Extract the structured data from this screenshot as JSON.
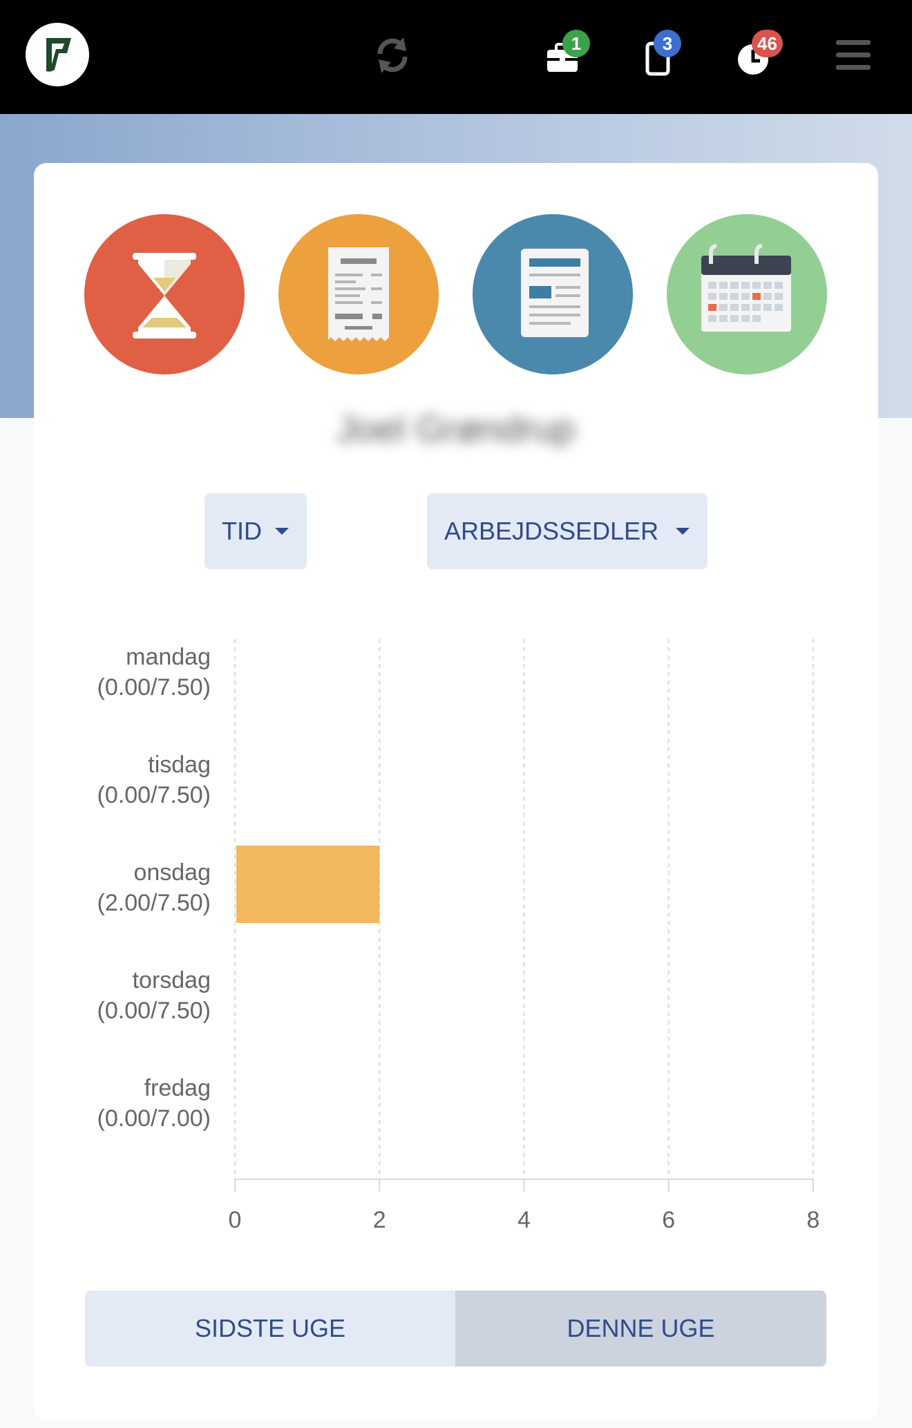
{
  "header": {
    "logo_icon": "app-logo-icon",
    "refresh_icon": "refresh-icon",
    "jobs": {
      "icon": "briefcase-icon",
      "badge": "1",
      "badge_color": "#3da14a"
    },
    "devices": {
      "icon": "phone-icon",
      "badge": "3",
      "badge_color": "#3b6fd0"
    },
    "timer": {
      "icon": "clock-icon",
      "badge": "46",
      "badge_color": "#d9534f"
    },
    "menu_icon": "hamburger-icon"
  },
  "modules": [
    {
      "icon": "hourglass-icon",
      "color": "#e06046"
    },
    {
      "icon": "receipt-icon",
      "color": "#eca03e"
    },
    {
      "icon": "document-icon",
      "color": "#4a89ab"
    },
    {
      "icon": "calendar-icon",
      "color": "#93cf93"
    }
  ],
  "user_name": "Joel Grøndrup",
  "dropdowns": {
    "tid": "TID",
    "arbejdssedler": "ARBEJDSSEDLER"
  },
  "chart_data": {
    "type": "bar",
    "orientation": "horizontal",
    "categories": [
      "mandag",
      "tisdag",
      "onsdag",
      "torsdag",
      "fredag"
    ],
    "category_sublabels": [
      "(0.00/7.50)",
      "(0.00/7.50)",
      "(2.00/7.50)",
      "(0.00/7.50)",
      "(0.00/7.00)"
    ],
    "values": [
      0,
      0,
      2,
      0,
      0
    ],
    "xlim": [
      0,
      8
    ],
    "xticks": [
      "0",
      "2",
      "4",
      "6",
      "8"
    ],
    "bar_color": "#f3b75e",
    "grid": true
  },
  "toggle": {
    "last_week": "SIDSTE UGE",
    "this_week": "DENNE UGE",
    "active": "DENNE UGE"
  }
}
